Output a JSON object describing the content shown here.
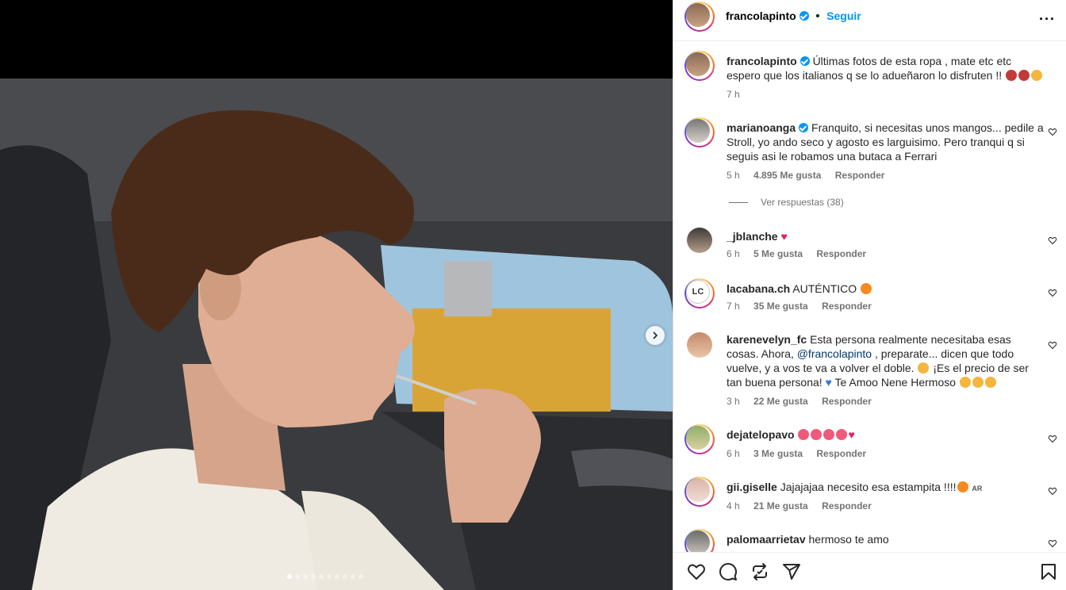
{
  "post": {
    "author": "francolapinto",
    "follow_label": "Seguir",
    "more_label": "···",
    "caption": "Últimas fotos de esta ropa , mate etc etc espero que los italianos q se lo adueñaron lo disfruten !!",
    "caption_time": "7 h"
  },
  "media": {
    "slide_count": 10,
    "active_slide": 0
  },
  "comments": [
    {
      "user": "marianoanga",
      "verified": true,
      "text": "Franquito, si necesitas unos mangos... pedile a Stroll, yo ando seco y agosto es larguisimo. Pero tranqui q si seguis asi le robamos una butaca a Ferrari",
      "time": "5 h",
      "likes": "4.895 Me gusta",
      "reply": "Responder",
      "view_replies": "Ver respuestas (38)"
    },
    {
      "user": "_jblanche",
      "text": "",
      "time": "6 h",
      "likes": "5 Me gusta",
      "reply": "Responder"
    },
    {
      "user": "lacabana.ch",
      "text": "AUTÉNTICO",
      "time": "7 h",
      "likes": "35 Me gusta",
      "reply": "Responder",
      "avatar_text": "LC"
    },
    {
      "user": "karenevelyn_fc",
      "text_a": "Esta persona realmente necesitaba esas cosas. Ahora, ",
      "mention": "@francolapinto",
      "text_b": " , preparate... dicen que todo vuelve, y a vos te va a volver el doble. ",
      "text_c": " ¡Es el precio de ser tan buena persona! ",
      "text_d": " Te Amoo Nene Hermoso",
      "time": "3 h",
      "likes": "22 Me gusta",
      "reply": "Responder"
    },
    {
      "user": "dejatelopavo",
      "text": "",
      "time": "6 h",
      "likes": "3 Me gusta",
      "reply": "Responder"
    },
    {
      "user": "gii.giselle",
      "text": "Jajajajaa necesito esa estampita !!!!",
      "flag": "AR",
      "time": "4 h",
      "likes": "21 Me gusta",
      "reply": "Responder"
    },
    {
      "user": "palomaarrietav",
      "text": "hermoso te amo"
    }
  ],
  "colors": {
    "link": "#0095f6",
    "verified": "#0095f6",
    "meta": "#737373",
    "heart": "#e0245e"
  },
  "icons": [
    "heart-icon",
    "comment-icon",
    "repost-icon",
    "share-icon",
    "bookmark-icon",
    "chevron-right-icon",
    "verified-icon"
  ]
}
